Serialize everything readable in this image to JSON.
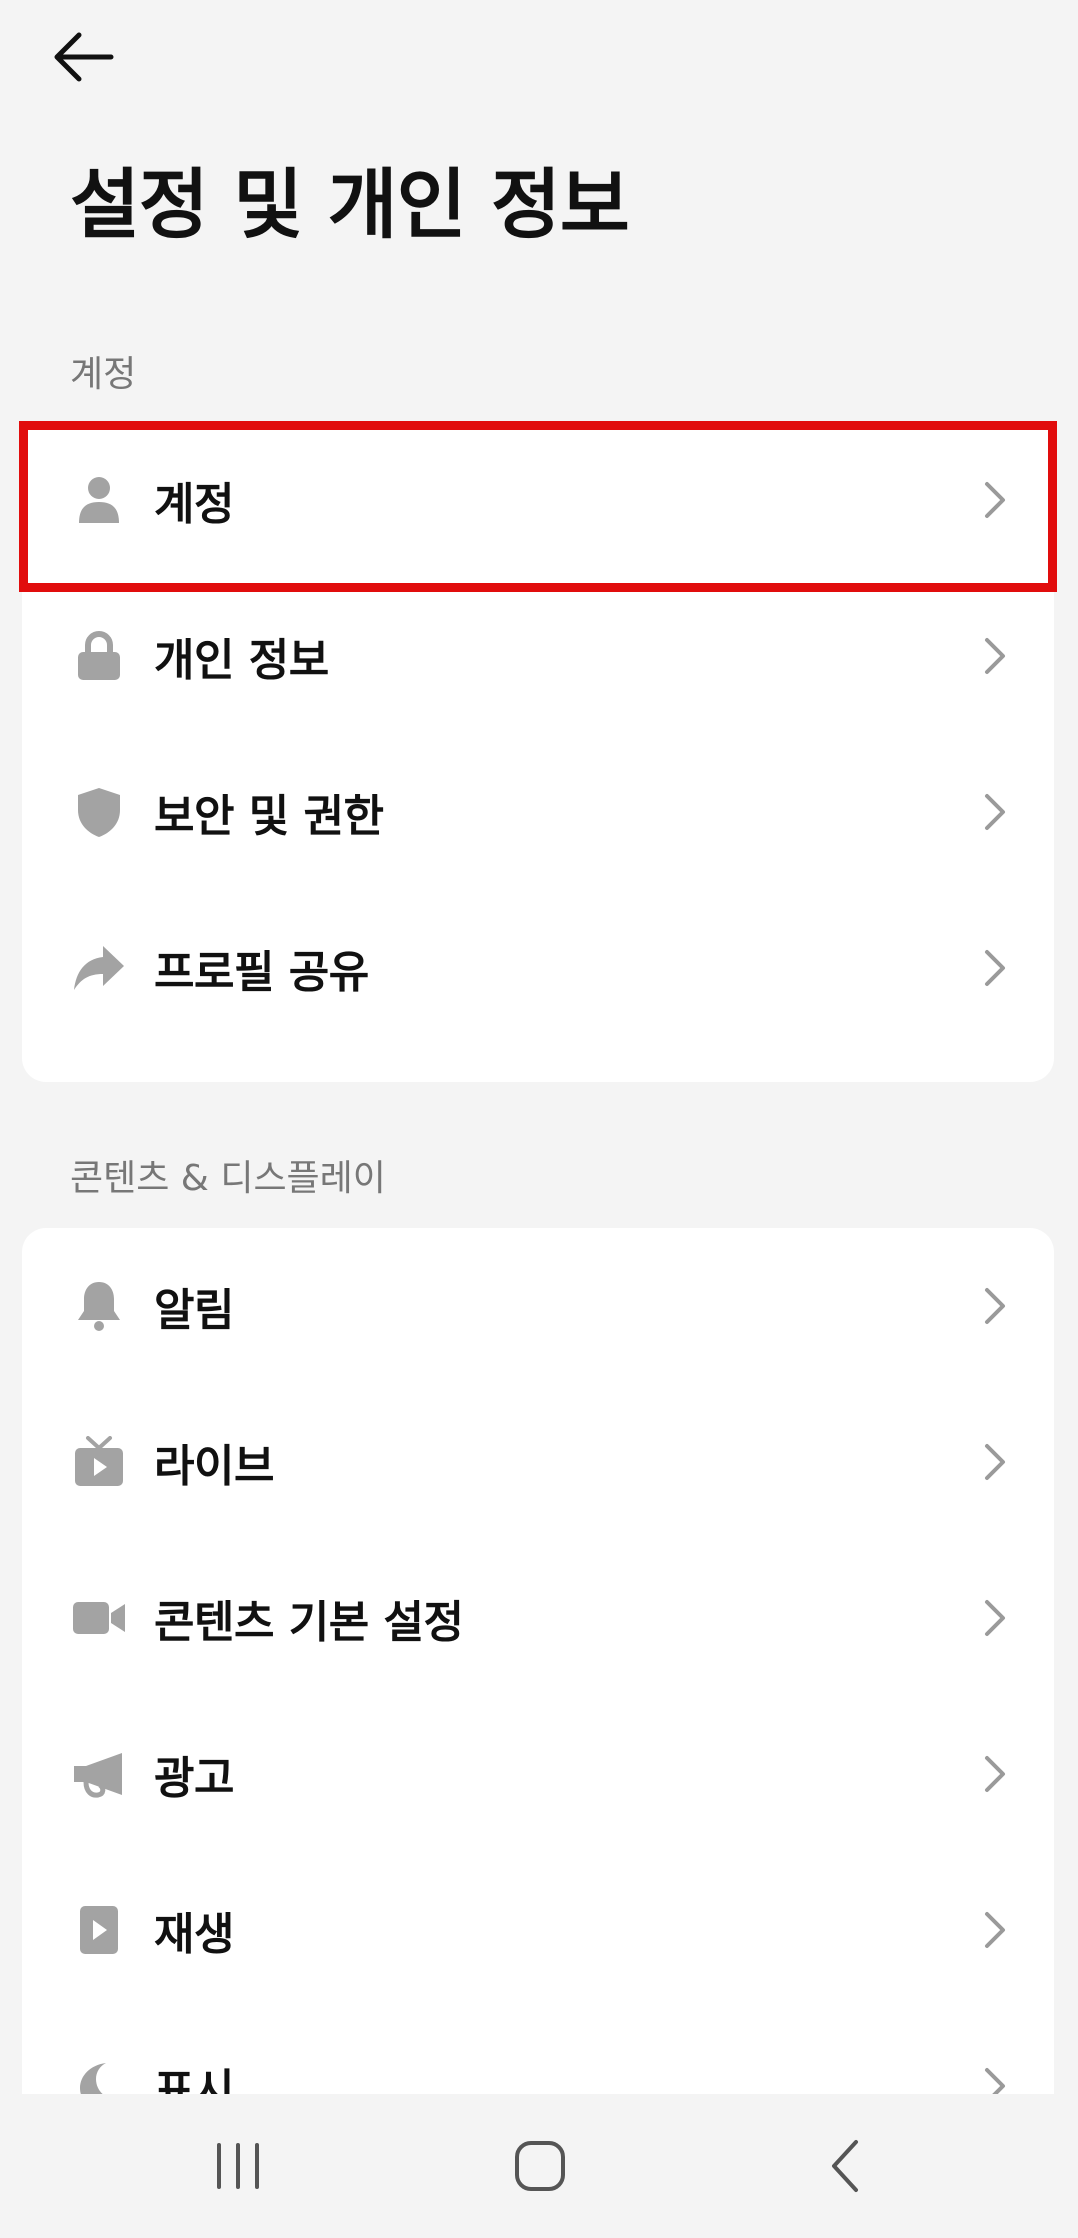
{
  "header": {
    "title": "설정 및 개인 정보"
  },
  "sections": [
    {
      "label": "계정",
      "items": [
        {
          "label": "계정",
          "icon": "person-icon"
        },
        {
          "label": "개인 정보",
          "icon": "lock-icon"
        },
        {
          "label": "보안 및 권한",
          "icon": "shield-icon"
        },
        {
          "label": "프로필 공유",
          "icon": "share-icon"
        }
      ]
    },
    {
      "label": "콘텐츠 & 디스플레이",
      "items": [
        {
          "label": "알림",
          "icon": "bell-icon"
        },
        {
          "label": "라이브",
          "icon": "tv-icon"
        },
        {
          "label": "콘텐츠 기본 설정",
          "icon": "video-camera-icon"
        },
        {
          "label": "광고",
          "icon": "megaphone-icon"
        },
        {
          "label": "재생",
          "icon": "play-icon"
        },
        {
          "label": "표시",
          "icon": "moon-icon"
        }
      ]
    }
  ],
  "colors": {
    "background": "#f4f4f4",
    "card": "#ffffff",
    "icon": "#a3a3a3",
    "highlight": "#e10d0d"
  },
  "system_nav": {
    "recent_icon": "recent-apps-icon",
    "home_icon": "home-icon",
    "back_icon": "back-icon"
  }
}
